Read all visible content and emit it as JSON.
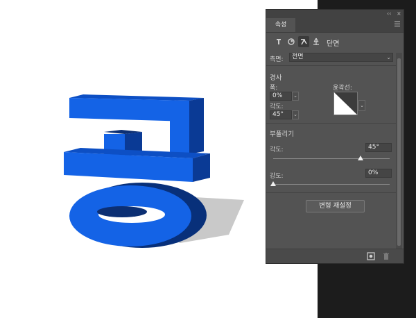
{
  "panel": {
    "tab_label": "속성",
    "topbar_collapse": "‹‹",
    "topbar_close": "×",
    "menu_icon": "hamburger-menu-icon",
    "icon_row_label": "단면",
    "side_label": "측면:",
    "side_value": "전면"
  },
  "bevel": {
    "heading": "경사",
    "width_label": "폭:",
    "width_value": "0%",
    "angle_label": "각도:",
    "angle_value": "45°",
    "contour_label": "윤곽선:"
  },
  "inflate": {
    "heading": "부풀리기",
    "angle_label": "각도:",
    "angle_value": "45°",
    "angle_slider_fraction": 0.75,
    "strength_label": "강도:",
    "strength_value": "0%",
    "strength_slider_fraction": 0.0
  },
  "reset_button": "변형 재설정",
  "colors": {
    "panel_bg": "#535353",
    "object_blue": "#1463e6",
    "canvas_bg": "#ffffff",
    "dark_strip": "#1c1c1c"
  }
}
